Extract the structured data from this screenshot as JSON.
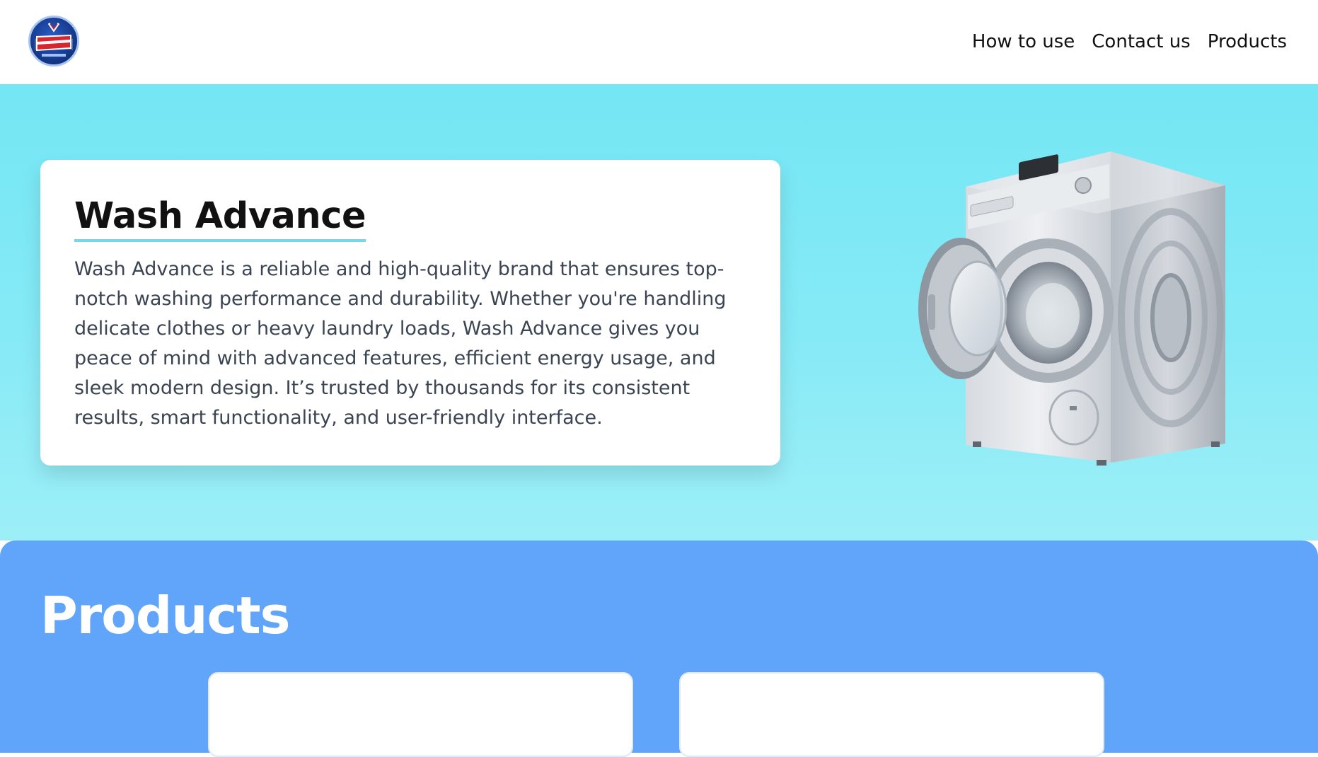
{
  "header": {
    "logo_alt": "Wash Advance",
    "nav": [
      {
        "label": "How to use"
      },
      {
        "label": "Contact us"
      },
      {
        "label": "Products"
      }
    ]
  },
  "hero": {
    "title": "Wash Advance",
    "description": "Wash Advance is a reliable and high-quality brand that ensures top-notch washing performance and durability. Whether you're handling delicate clothes or heavy laundry loads, Wash Advance gives you peace of mind with advanced features, efficient energy usage, and sleek modern design. It’s trusted by thousands for its consistent results, smart functionality, and user-friendly interface.",
    "image": "washing-machine-icon"
  },
  "products": {
    "title": "Products"
  },
  "colors": {
    "hero_bg": "#74e6f4",
    "products_bg": "#60a5fa",
    "accent_underline": "#74d8e8"
  }
}
